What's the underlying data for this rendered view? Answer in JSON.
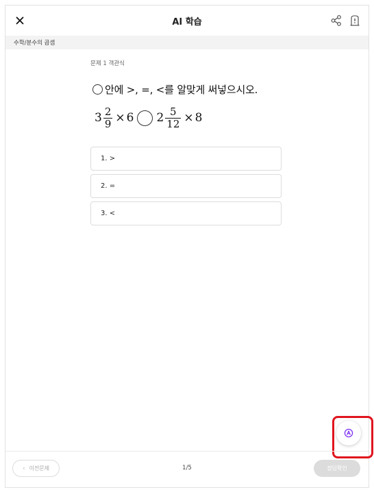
{
  "header": {
    "title": "AI 학습"
  },
  "breadcrumb": "수학/분수의 곱셈",
  "question": {
    "type_label": "문제 1 객관식",
    "instruction": "안에 >, =, <를 알맞게 써넣으시오.",
    "expression": {
      "left_whole": "3",
      "left_num": "2",
      "left_den": "9",
      "left_op": "×",
      "left_factor": "6",
      "right_whole": "2",
      "right_num": "5",
      "right_den": "12",
      "right_op": "×",
      "right_factor": "8"
    }
  },
  "options": [
    {
      "label": "1. >"
    },
    {
      "label": "2. ="
    },
    {
      "label": "3. <"
    }
  ],
  "footer": {
    "prev_label": "이전문제",
    "page_indicator": "1/5",
    "check_label": "정답확인"
  },
  "colors": {
    "accent": "#7b2ff2",
    "highlight": "#e0141e"
  },
  "icons": [
    "close-icon",
    "share-icon",
    "bookmark-icon",
    "chevron-left-icon",
    "ai-assistant-icon"
  ]
}
